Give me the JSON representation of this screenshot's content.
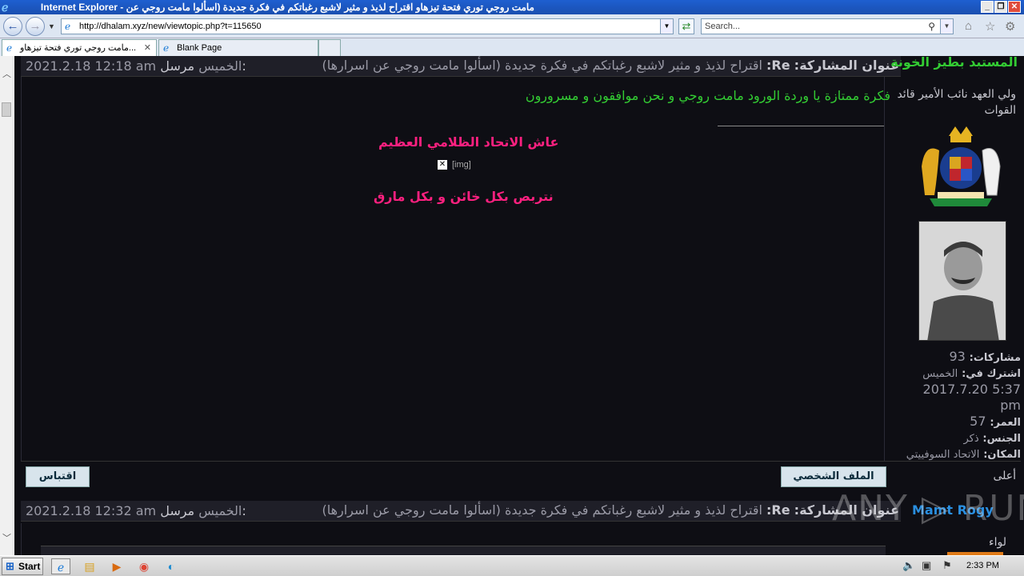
{
  "window": {
    "title": "مامت روجي توري فتحة تيزهاو اقتراح لذيذ و مثير لاشبع رغباتكم في فكرة جديدة (اسألوا مامت روجي عن - Internet Explorer",
    "minimize": "_",
    "restore": "❐",
    "close": "✕"
  },
  "browser": {
    "address": "http://dhalam.xyz/new/viewtopic.php?t=115650",
    "search_placeholder": "Search...",
    "tabs": [
      {
        "label": "مامت روجي توري فتحة تيزهاو...",
        "active": true
      },
      {
        "label": "Blank Page",
        "active": false
      }
    ]
  },
  "post1": {
    "author": "المستبد بطيز الخونة",
    "author_color": "#33cc33",
    "subject_label": "عنوان المشاركة:",
    "subject_re": "Re:",
    "subject": "اقتراح لذيذ و مثير لاشبع رغباتكم في فكرة جديدة (اسألوا مامت روجي عن اسرارها)",
    "posted_label": "مرسل:",
    "posted_day": "الخميس",
    "posted_datetime": "2021.2.18 12:18 am",
    "rank": "ولي العهد نائب الأمير قائد القوات",
    "body": "فكرة ممتازة يا وردة الورود مامت روجي و نحن موافقون و مسرورون",
    "signature_line1": "عاش الاتحاد الظلامي العظيم",
    "signature_img": "[img]",
    "signature_line2": "نتربص بكل خائن و بكل مارق",
    "stats": {
      "posts_label": "مشاركات:",
      "posts": "93",
      "joined_label": "اشترك في:",
      "joined_day": "الخميس",
      "joined_datetime": "2017.7.20 5:37 pm",
      "age_label": "العمر:",
      "age": "57",
      "gender_label": "الجنس:",
      "gender": "ذكر",
      "location_label": "المكان:",
      "location": "الاتحاد السوفييتي"
    },
    "profile_button": "الملف الشخصي",
    "quote_button": "اقتباس",
    "back_to_top": "أعلى"
  },
  "post2": {
    "author": "Mamt Rogy",
    "author_color": "#2a8fe0",
    "subject_label": "عنوان المشاركة:",
    "subject_re": "Re:",
    "subject": "اقتراح لذيذ و مثير لاشبع رغباتكم في فكرة جديدة (اسألوا مامت روجي عن اسرارها)",
    "posted_label": "مرسل:",
    "posted_day": "الخميس",
    "posted_datetime": "2021.2.18 12:32 am",
    "rank": "لواء"
  },
  "watermark": "ANY ▷ RUN",
  "taskbar": {
    "start": "Start",
    "clock": "2:33 PM"
  }
}
